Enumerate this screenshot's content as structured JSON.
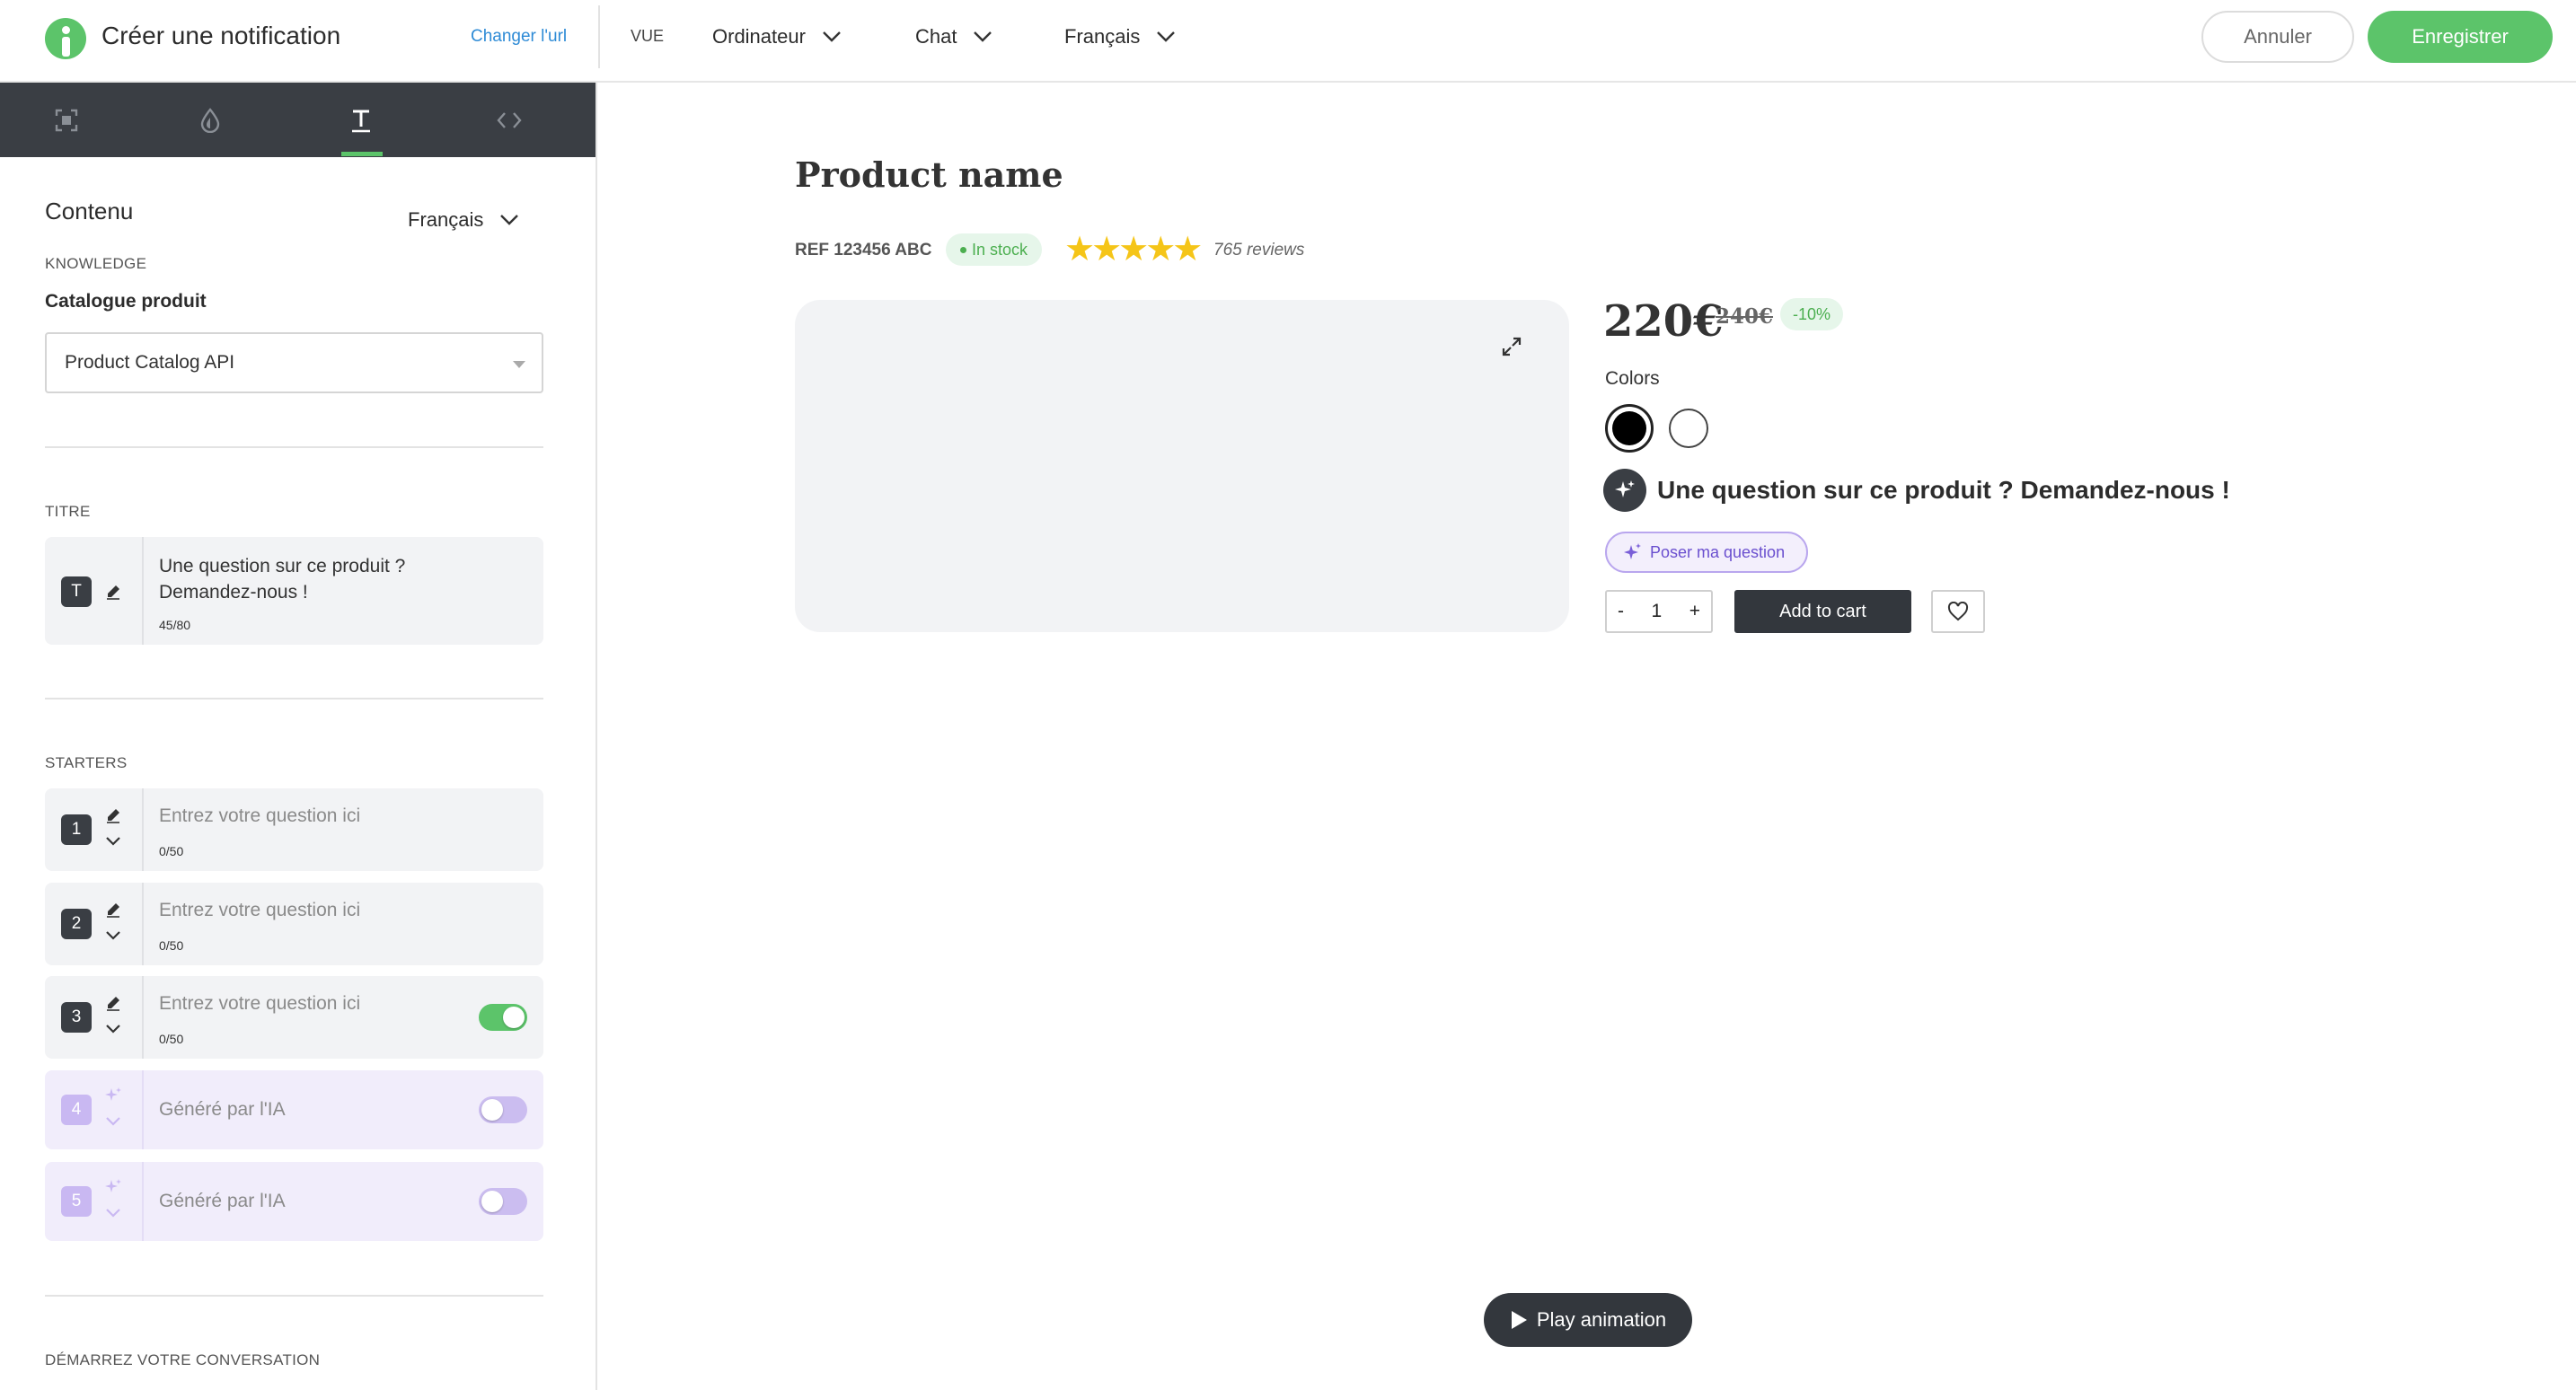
{
  "header": {
    "title": "Créer une notification",
    "change_url": "Changer l'url",
    "view_label": "VUE",
    "device": "Ordinateur",
    "mode": "Chat",
    "language": "Français",
    "cancel": "Annuler",
    "save": "Enregistrer"
  },
  "colors": {
    "accent": "#5cc46a",
    "dark": "#3a3e44",
    "link": "#2e8bd6",
    "ai_purple": "#6a4fcf"
  },
  "sidebar": {
    "tabs": [
      {
        "icon": "frame-icon"
      },
      {
        "icon": "drop-icon"
      },
      {
        "icon": "text-icon",
        "active": true
      },
      {
        "icon": "code-icon"
      }
    ],
    "section_title": "Contenu",
    "language": "Français",
    "knowledge_label": "KNOWLEDGE",
    "catalog_label": "Catalogue produit",
    "catalog_value": "Product Catalog API",
    "title_label": "TITRE",
    "title_badge": "T",
    "title_line1": "Une question sur ce produit ?",
    "title_line2": "Demandez-nous !",
    "title_counter": "45/80",
    "starters_label": "STARTERS",
    "starters": [
      {
        "num": "1",
        "placeholder": "Entrez votre question ici",
        "counter": "0/50"
      },
      {
        "num": "2",
        "placeholder": "Entrez votre question ici",
        "counter": "0/50"
      },
      {
        "num": "3",
        "placeholder": "Entrez votre question ici",
        "counter": "0/50",
        "enabled": true
      }
    ],
    "ai_starters": [
      {
        "num": "4",
        "label": "Généré par l'IA",
        "enabled": false
      },
      {
        "num": "5",
        "label": "Généré par l'IA",
        "enabled": false
      }
    ],
    "conversation_label": "DÉMARREZ VOTRE CONVERSATION"
  },
  "preview": {
    "product_name": "Product name",
    "ref": "REF 123456 ABC",
    "stock": "In stock",
    "rating": 5,
    "stars": "★★★★★",
    "reviews": "765 reviews",
    "price": "220€",
    "old_price": "240€",
    "discount": "-10%",
    "colors_label": "Colors",
    "color_options": [
      "black",
      "white"
    ],
    "question_title": "Une question sur ce produit ? Demandez-nous !",
    "ask_button": "Poser ma question",
    "qty_minus": "-",
    "qty_value": "1",
    "qty_plus": "+",
    "add_to_cart": "Add to cart",
    "play_animation": "Play animation"
  }
}
